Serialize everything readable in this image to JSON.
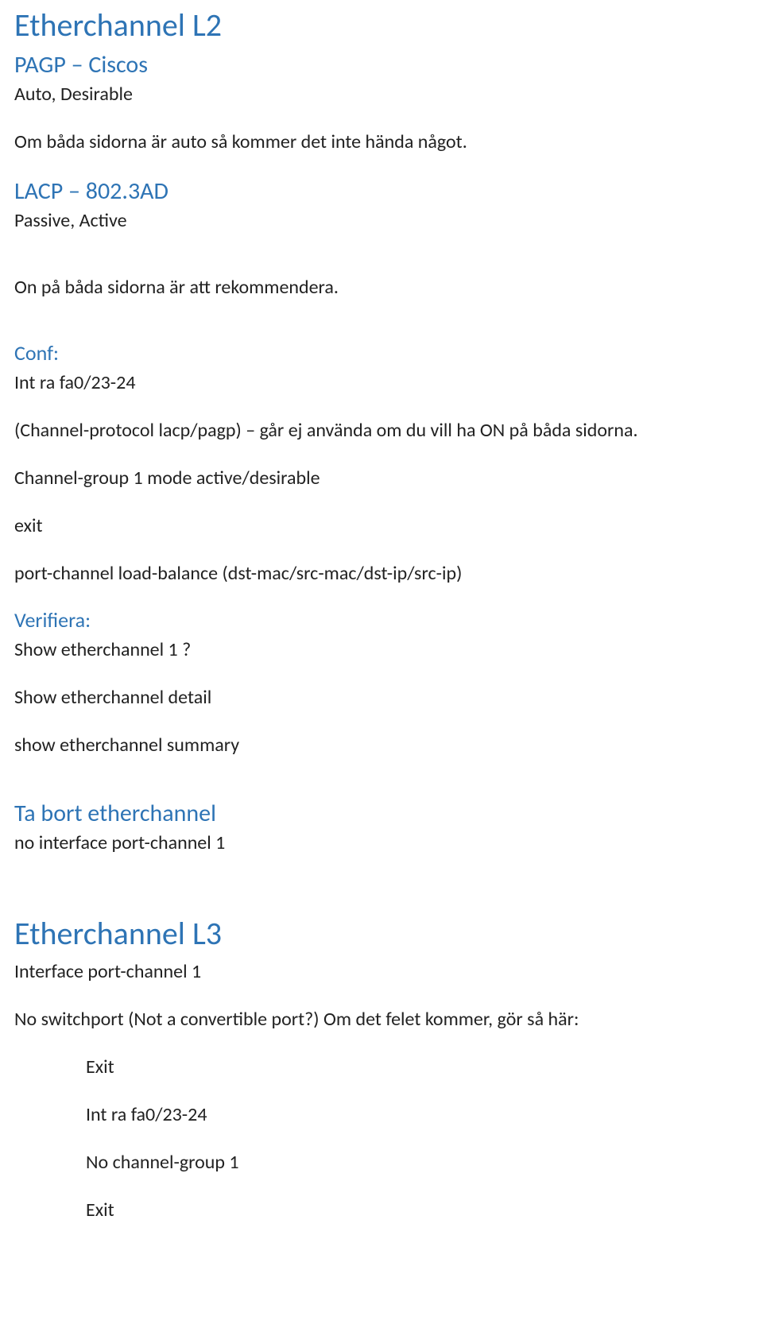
{
  "sections": {
    "l2": {
      "title": "Etherchannel L2",
      "pagp": {
        "heading": "PAGP – Ciscos",
        "modes": "Auto, Desirable",
        "note": "Om båda sidorna är auto så kommer det inte hända något."
      },
      "lacp": {
        "heading": "LACP – 802.3AD",
        "modes": "Passive, Active",
        "note": "On på båda sidorna är att rekommendera."
      },
      "conf": {
        "heading": "Conf:",
        "lines": {
          "l1": "Int ra fa0/23-24",
          "l2": "(Channel-protocol lacp/pagp) – går ej använda om du vill ha ON på båda sidorna.",
          "l3": "Channel-group 1 mode active/desirable",
          "l4": "exit",
          "l5": "port-channel load-balance (dst-mac/src-mac/dst-ip/src-ip)"
        }
      },
      "verify": {
        "heading": "Verifiera:",
        "lines": {
          "l1": "Show etherchannel 1 ?",
          "l2": "Show etherchannel detail",
          "l3": "show etherchannel summary"
        }
      },
      "remove": {
        "heading": "Ta bort etherchannel",
        "lines": {
          "l1": "no interface port-channel 1"
        }
      }
    },
    "l3": {
      "title": "Etherchannel L3",
      "lines": {
        "l1": "Interface port-channel 1",
        "l2": "No switchport (Not a convertible port?) Om det felet kommer, gör så här:"
      },
      "indent_lines": {
        "i1": "Exit",
        "i2": "Int ra fa0/23-24",
        "i3": "No channel-group 1",
        "i4": "Exit"
      }
    }
  }
}
